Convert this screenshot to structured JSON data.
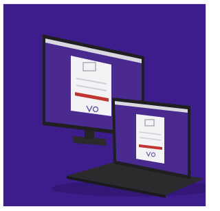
{
  "scene": {
    "description_text": "",
    "background_color": "#3d1d8c",
    "desktop": {
      "kind": "desktop-monitor",
      "screen_background": "#4a2a8f",
      "browser_chrome": "#d8d8de",
      "login_card": {
        "logo_text": "",
        "button_color": "#c0352f"
      }
    },
    "laptop": {
      "kind": "laptop",
      "screen_background": "#4a2a8f",
      "browser_chrome": "#d8d8de",
      "login_card": {
        "logo_text": "",
        "button_color": "#c0352f"
      }
    },
    "icons": {
      "desktop_logo": "brand-logo-icon",
      "laptop_logo": "brand-logo-icon"
    }
  }
}
